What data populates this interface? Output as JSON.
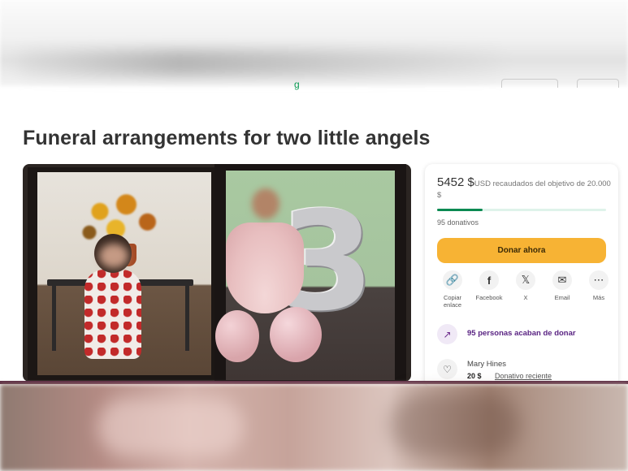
{
  "header": {
    "nav_fragment": "g"
  },
  "campaign": {
    "title": "Funeral arrangements for two little angels"
  },
  "progress": {
    "amount": "5452 $",
    "currency_text": "USD recaudados del objetivo de 20.000 $",
    "fraction": 0.27,
    "donations": "95 donativos",
    "fill_color": "#0b8a52"
  },
  "actions": {
    "donate_label": "Donar ahora",
    "donate_color": "#f7b334"
  },
  "share": [
    {
      "icon": "link-icon",
      "glyph": "🔗",
      "label": "Copiar enlace"
    },
    {
      "icon": "facebook-icon",
      "glyph": "f",
      "label": "Facebook"
    },
    {
      "icon": "x-icon",
      "glyph": "𝕏",
      "label": "X"
    },
    {
      "icon": "email-icon",
      "glyph": "✉",
      "label": "Email"
    },
    {
      "icon": "more-icon",
      "glyph": "⋯",
      "label": "Más"
    }
  ],
  "activity": {
    "people_text": "95 personas acaban de donar",
    "recent_name": "Mary Hines",
    "recent_amount": "20 $",
    "recent_tag": "Donativo reciente"
  },
  "image": {
    "digit": "3"
  }
}
